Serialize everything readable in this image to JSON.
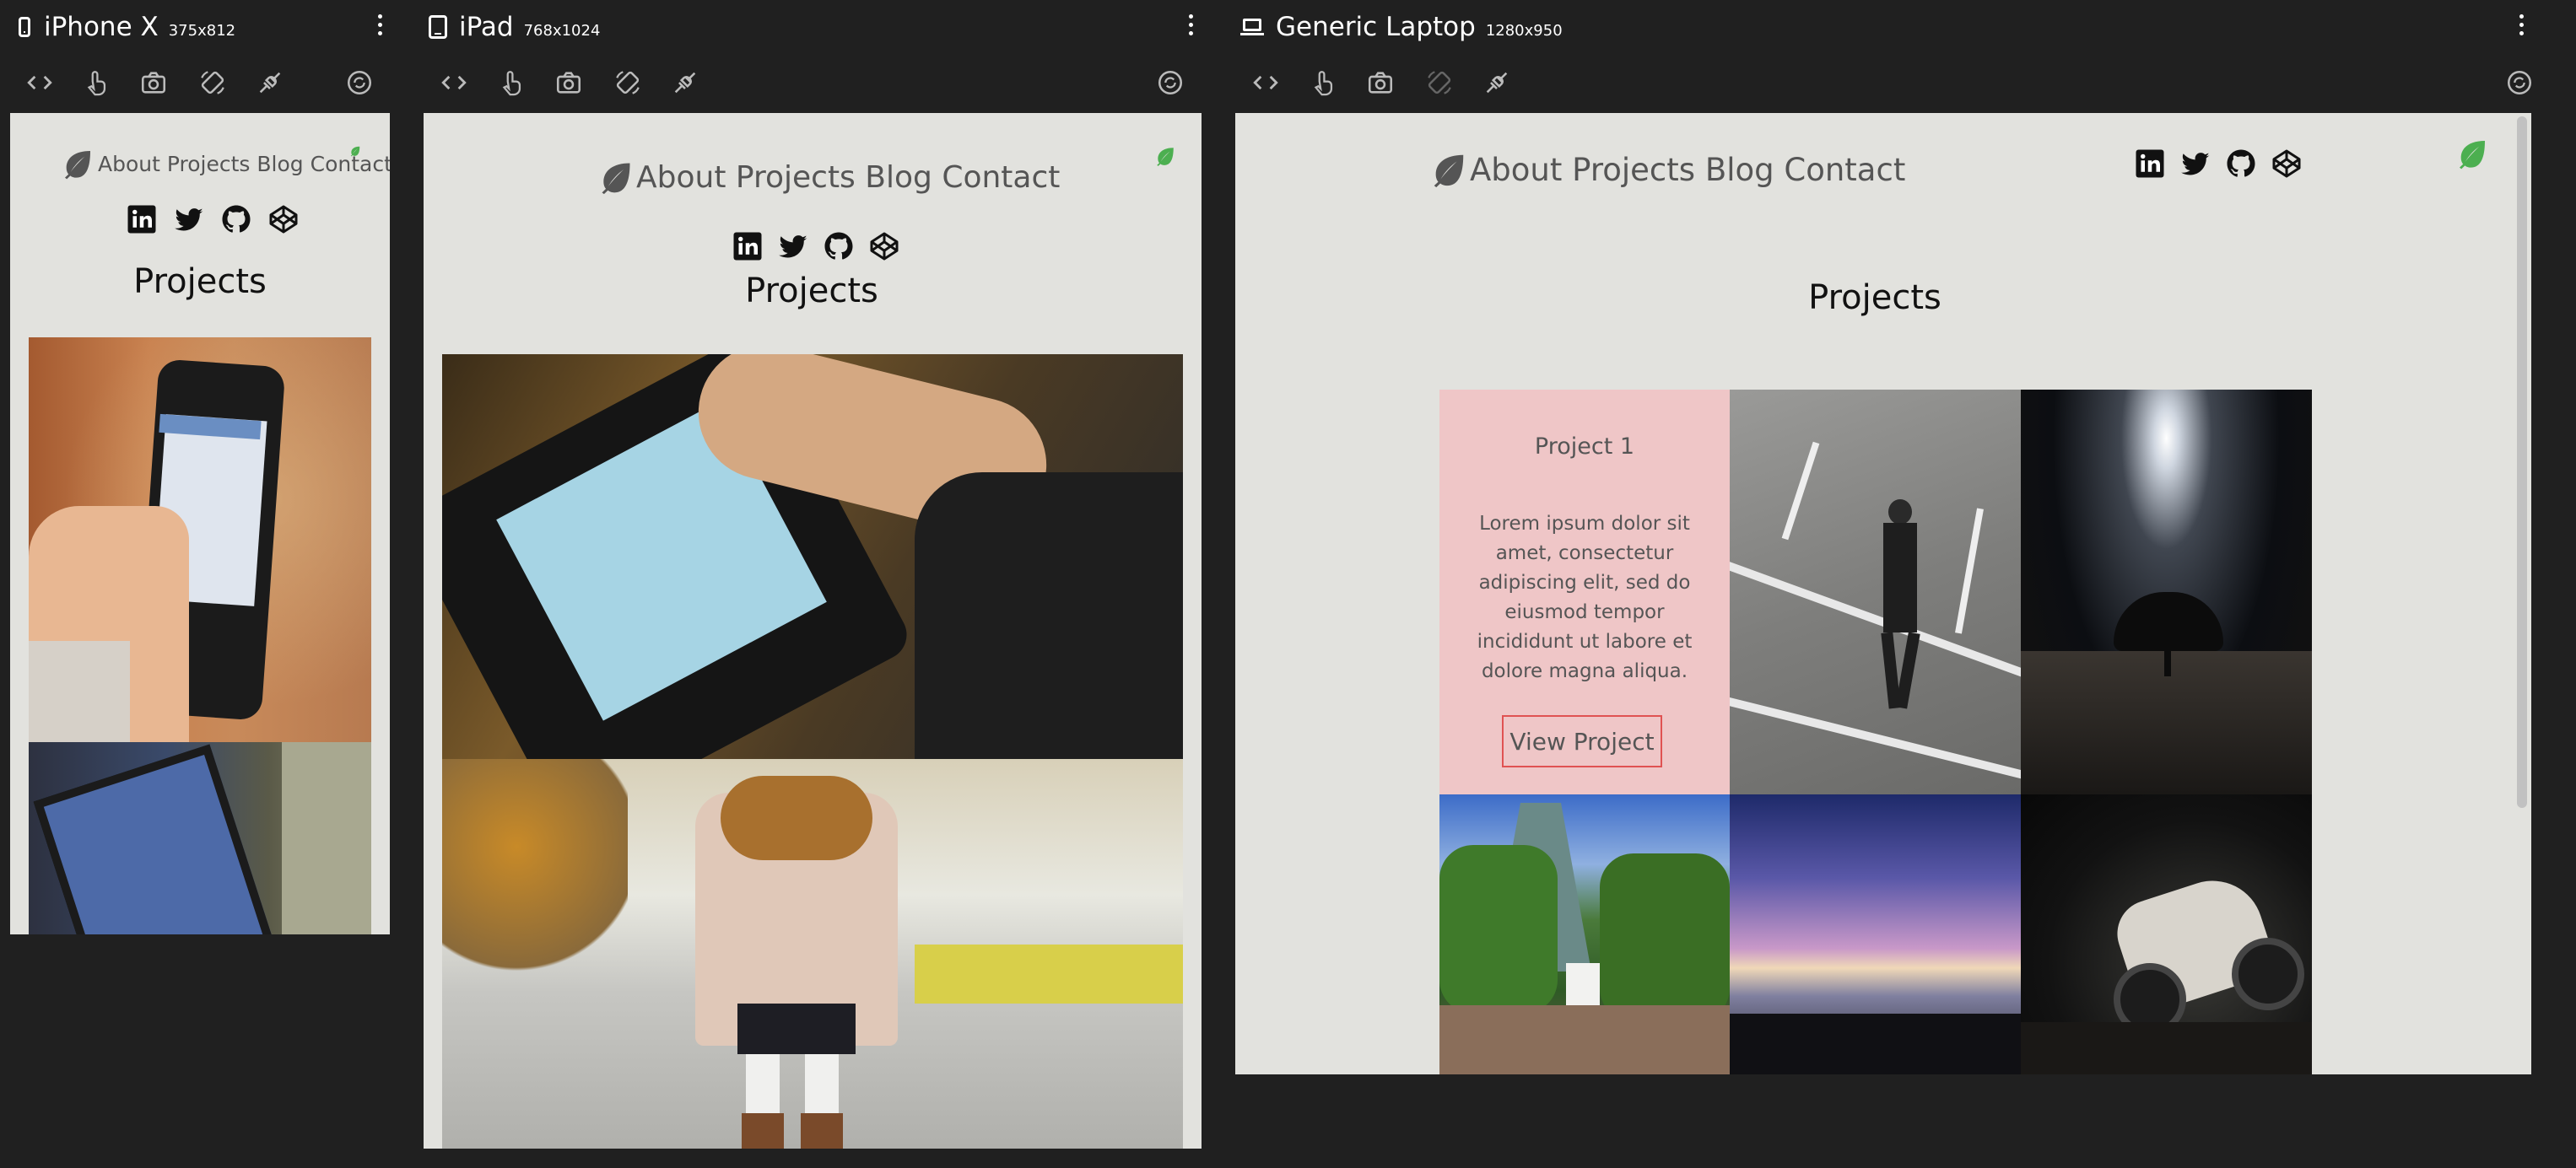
{
  "devices": [
    {
      "name": "iPhone X",
      "size": "375x812"
    },
    {
      "name": "iPad",
      "size": "768x1024"
    },
    {
      "name": "Generic Laptop",
      "size": "1280x950"
    }
  ],
  "site": {
    "nav": [
      "About",
      "Projects",
      "Blog",
      "Contact"
    ],
    "heading": "Projects",
    "social_icons": [
      "linkedin-icon",
      "twitter-icon",
      "github-icon",
      "codepen-icon"
    ]
  },
  "laptop_card": {
    "title": "Project 1",
    "body": "Lorem ipsum dolor sit amet, consectetur adipiscing elit, sed do eiusmod tempor incididunt ut labore et dolore magna aliqua.",
    "button": "View Project"
  },
  "colors": {
    "app_bg": "#202020",
    "site_bg": "#e2e2de",
    "card_bg": "#efc6c7",
    "button_border": "#e05252",
    "leaf_green": "#4caf50"
  }
}
